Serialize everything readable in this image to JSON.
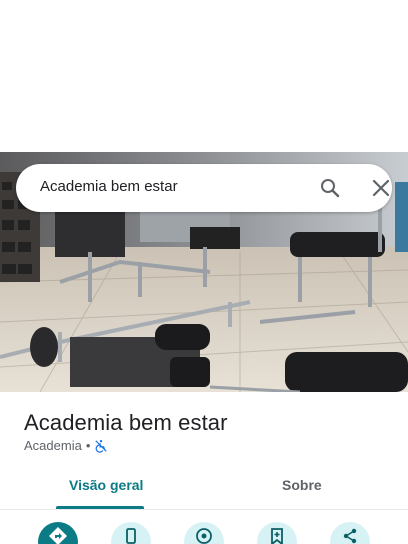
{
  "search": {
    "value": "Academia bem estar",
    "search_icon": "search-icon",
    "close_icon": "close-icon"
  },
  "photo": {
    "description_icon": "gym-photo"
  },
  "place": {
    "title": "Academia bem estar",
    "category": "Academia",
    "separator": "•",
    "accessibility_icon": "not-accessible-icon"
  },
  "tabs": [
    {
      "label": "Visão geral",
      "selected": true
    },
    {
      "label": "Sobre",
      "selected": false
    }
  ],
  "actions": [
    {
      "icon": "directions-icon",
      "primary": true
    },
    {
      "icon": "call-icon",
      "primary": false
    },
    {
      "icon": "street-view-icon",
      "primary": false
    },
    {
      "icon": "save-icon",
      "primary": false
    },
    {
      "icon": "share-icon",
      "primary": false
    }
  ],
  "colors": {
    "accent": "#0b7b85",
    "action_bg": "#d6f2f5",
    "text_primary": "#202124",
    "text_secondary": "#5f6368",
    "accessibility_blue": "#1a73e8"
  }
}
